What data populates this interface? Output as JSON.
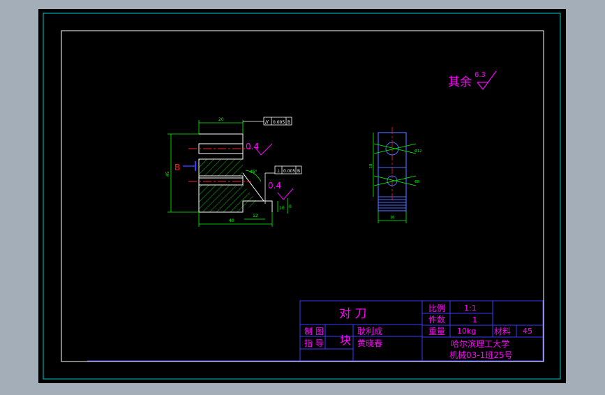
{
  "colors": {
    "background": "#a3aeb8",
    "paper": "#000000",
    "frame_outer": "#00c8c8",
    "frame_inner": "#ffffff",
    "title_block": "#3a3aff",
    "magenta": "#ff00ff",
    "green": "#00ff00",
    "white": "#ffffff",
    "red": "#ff2020",
    "cyan": "#00ffff",
    "part_blue": "#4a6bff"
  },
  "roughness_note": {
    "label": "其余",
    "value": "6.3"
  },
  "front_view": {
    "dim_top": "20",
    "dim_height": "45",
    "dim_bottom": "40",
    "dim_bottom_small": "12",
    "dim_right": "10",
    "datum_letter": "B",
    "angle": "45°",
    "roughness_1": "0.4",
    "roughness_2": "0.4",
    "tolerance_1": {
      "symbol": "//",
      "value": "0.005",
      "datum": "B"
    },
    "tolerance_2": {
      "symbol": "⊥",
      "value": "0.005",
      "datum": "B"
    }
  },
  "side_view": {
    "dim_height": "18",
    "dim_width": "16",
    "hole_label_1": "Φ12",
    "hole_label_2": "Φ8"
  },
  "title_block": {
    "part_name": "对 刀",
    "drawn_label": "制  图",
    "drawn_name": "耿利成",
    "checked_label": "指  导",
    "checked_name": "黄晓春",
    "block_label": "块",
    "scale_label": "比例",
    "scale_value": "1:1",
    "qty_label": "件数",
    "qty_value": "1",
    "weight_label": "重量",
    "weight_value": "10kg",
    "material_label": "材料",
    "material_value": "45",
    "school": "哈尔滨理工大学",
    "class": "机械03-1班25号"
  }
}
